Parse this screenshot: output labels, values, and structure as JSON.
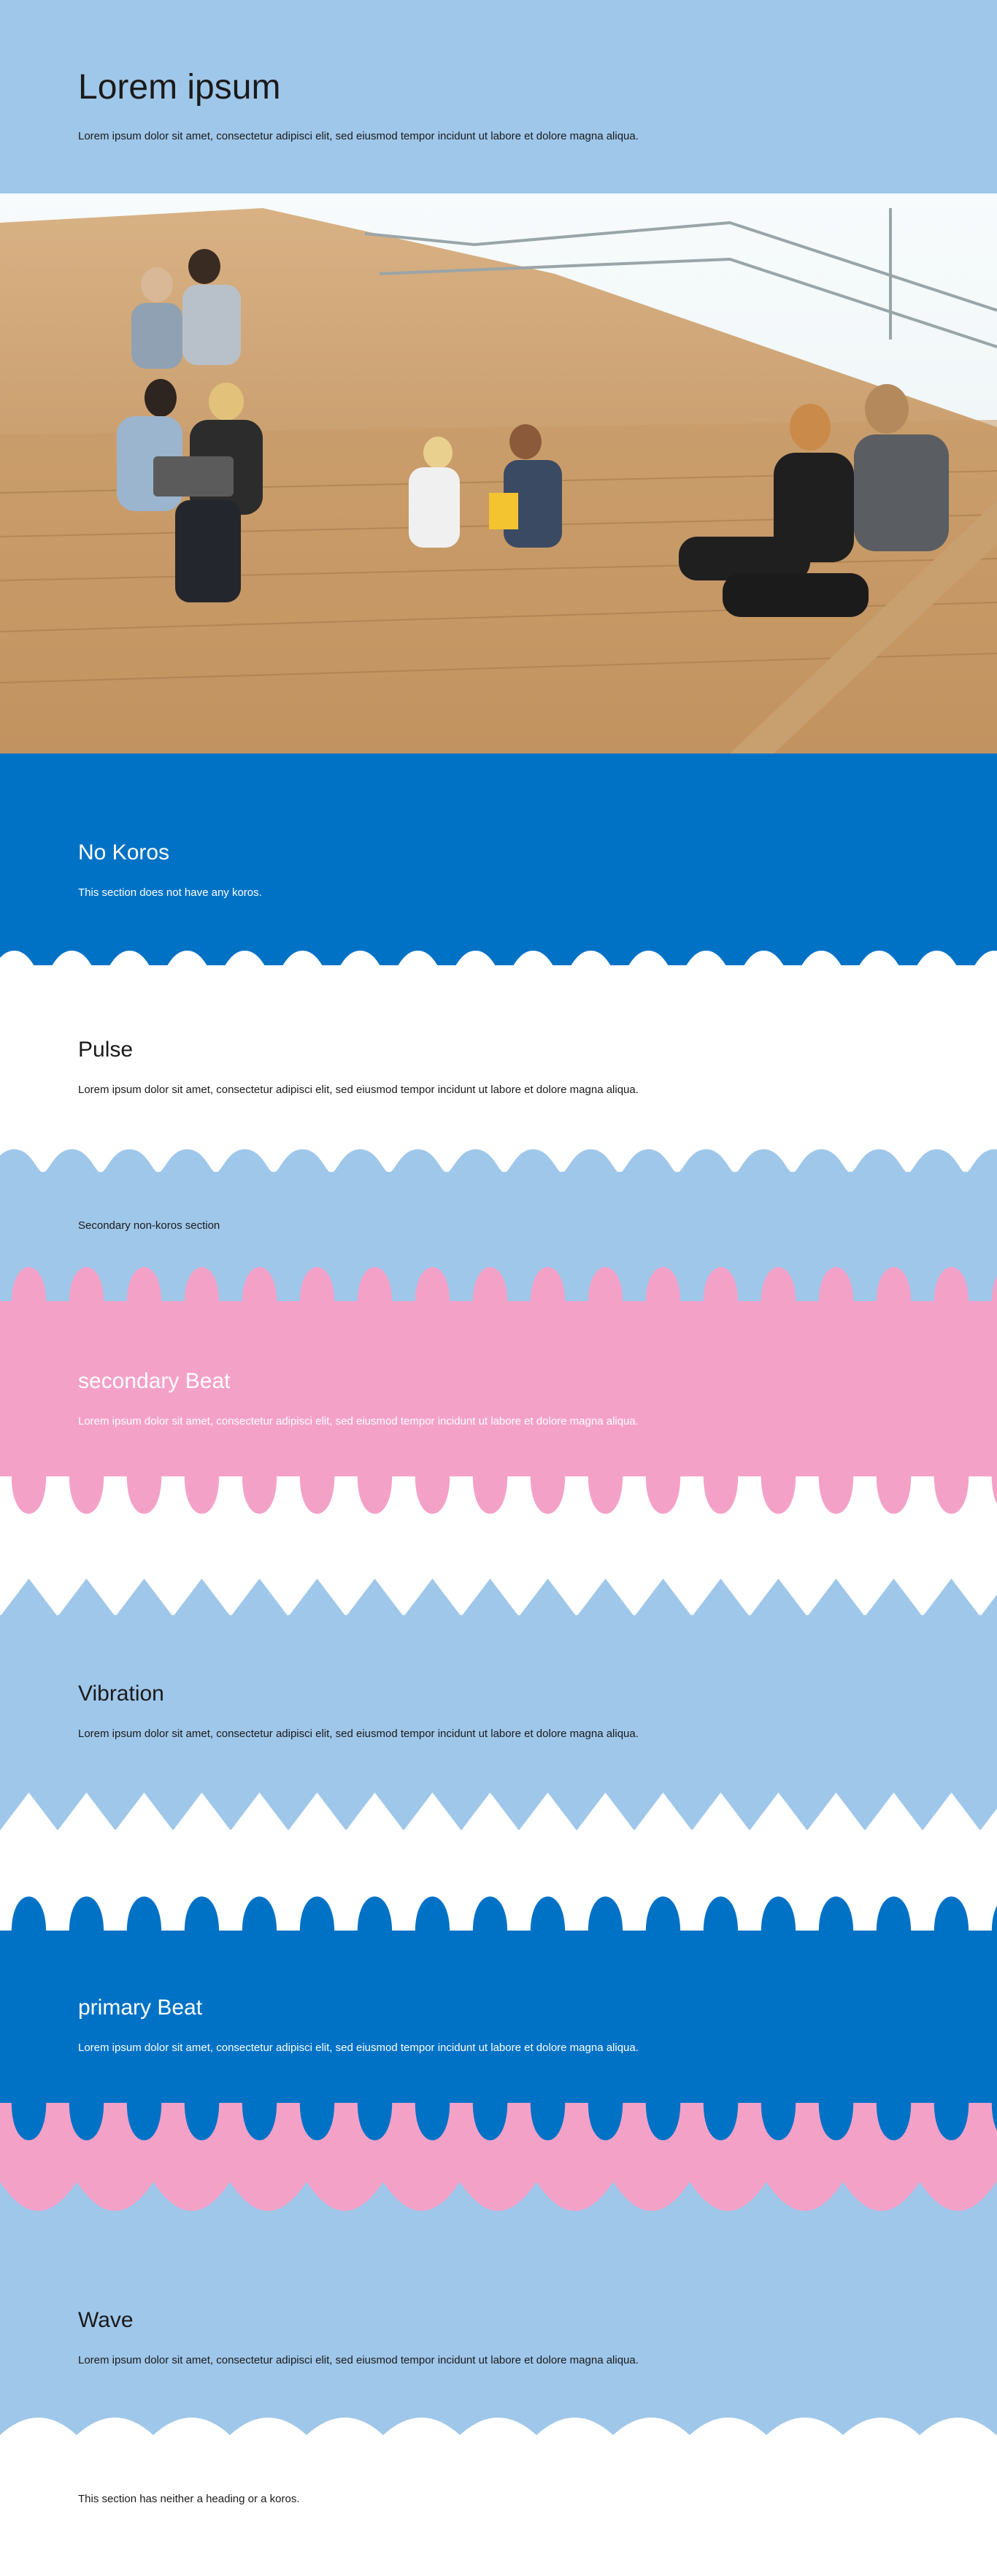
{
  "hero": {
    "title": "Lorem ipsum",
    "text": "Lorem ipsum dolor sit amet, consectetur adipisci elit, sed eiusmod tempor incidunt ut labore et dolore magna aliqua.",
    "image_alt": "People reading and using devices on wooden library stairs"
  },
  "sections": {
    "no_koros": {
      "title": "No Koros",
      "text": "This section does not have any koros."
    },
    "pulse": {
      "title": "Pulse",
      "text": "Lorem ipsum dolor sit amet, consectetur adipisci elit, sed eiusmod tempor incidunt ut labore et dolore magna aliqua."
    },
    "secondary_non_koros": {
      "text": "Secondary non-koros section"
    },
    "secondary_beat": {
      "title": "secondary Beat",
      "text": "Lorem ipsum dolor sit amet, consectetur adipisci elit, sed eiusmod tempor incidunt ut labore et dolore magna aliqua."
    },
    "vibration": {
      "title": "Vibration",
      "text": "Lorem ipsum dolor sit amet, consectetur adipisci elit, sed eiusmod tempor incidunt ut labore et dolore magna aliqua."
    },
    "primary_beat": {
      "title": "primary Beat",
      "text": "Lorem ipsum dolor sit amet, consectetur adipisci elit, sed eiusmod tempor incidunt ut labore et dolore magna aliqua."
    },
    "wave": {
      "title": "Wave",
      "text": "Lorem ipsum dolor sit amet, consectetur adipisci elit, sed eiusmod tempor incidunt ut labore et dolore magna aliqua."
    },
    "no_heading": {
      "text": "This section has neither a heading or a koros."
    }
  },
  "colors": {
    "light_blue": "#9fc7ea",
    "primary_blue": "#0072c6",
    "pink": "#f4a1c8",
    "white": "#ffffff",
    "text_dark": "#1a1a1a"
  }
}
